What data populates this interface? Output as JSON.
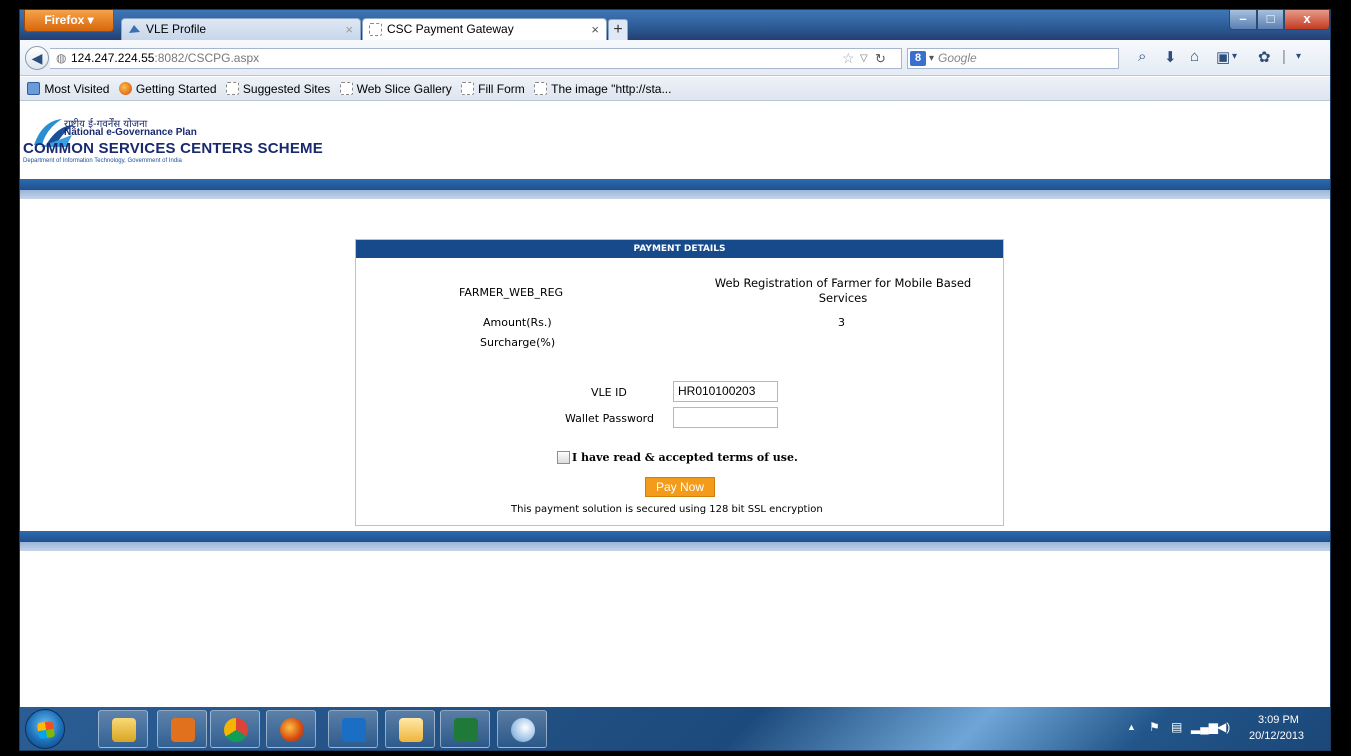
{
  "browser": {
    "menu_label": "Firefox",
    "tabs": [
      {
        "title": "VLE Profile",
        "active": false
      },
      {
        "title": "CSC Payment Gateway",
        "active": true
      }
    ],
    "tab_close_glyph": "×",
    "new_tab_glyph": "+",
    "window_buttons": {
      "minimize": "–",
      "maximize": "□",
      "close": "x"
    },
    "url": {
      "host": "124.247.224.55",
      "path": ":8082/CSCPG.aspx"
    },
    "search": {
      "engine_icon": "8",
      "placeholder": "Google"
    },
    "bookmarks": [
      "Most Visited",
      "Getting Started",
      "Suggested Sites",
      "Web Slice Gallery",
      "Fill Form",
      "The image \"http://sta..."
    ]
  },
  "header": {
    "hindi_text": "राष्ट्रीय ई-गवर्नेंस योजना",
    "plan": "National e-Governance Plan",
    "scheme": "COMMON SERVICES CENTERS SCHEME",
    "department": "Department of Information Technology, Government of India"
  },
  "payment": {
    "title": "PAYMENT DETAILS",
    "service_code": "FARMER_WEB_REG",
    "service_description": "Web Registration of Farmer for Mobile Based Services",
    "amount_label": "Amount(Rs.)",
    "amount_value": "3",
    "surcharge_label": "Surcharge(%)",
    "vle_id_label": "VLE ID",
    "vle_id_value": "HR010100203",
    "wallet_password_label": "Wallet Password",
    "wallet_password_value": "",
    "terms_label": "I have read & accepted terms of use.",
    "terms_checked": false,
    "pay_button": "Pay Now",
    "ssl_note": "This payment solution is secured using 128 bit SSL encryption"
  },
  "taskbar": {
    "apps": [
      "windows-explorer",
      "outlook",
      "chrome",
      "firefox",
      "maxthon",
      "mail",
      "excel",
      "paint"
    ],
    "clock_time": "3:09 PM",
    "clock_date": "20/12/2013"
  },
  "colors": {
    "header_blue": "#164a8a",
    "stripe_blue": "#1f4f8e",
    "pay_button": "#f39c1c",
    "firefox_orange": "#e8781a"
  }
}
